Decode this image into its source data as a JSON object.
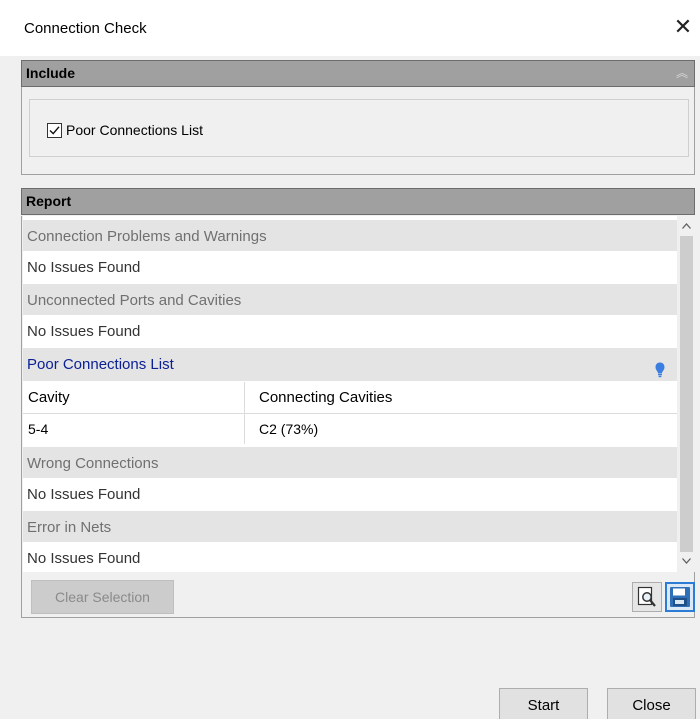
{
  "window": {
    "title": "Connection Check",
    "close_glyph": "✕"
  },
  "include": {
    "header": "Include",
    "collapse_glyph": "︽",
    "checkbox": {
      "label": "Poor Connections List",
      "checked": true
    }
  },
  "report": {
    "header": "Report",
    "groups": [
      {
        "title": "Connection Problems and Warnings",
        "value": "No Issues Found"
      },
      {
        "title": "Unconnected Ports and Cavities",
        "value": "No Issues Found"
      },
      {
        "title": "Poor Connections List",
        "icon": "lightbulb-icon"
      },
      {
        "title": "Wrong Connections",
        "value": "No Issues Found"
      },
      {
        "title": "Error in Nets",
        "value": "No Issues Found"
      }
    ],
    "table": {
      "columns": [
        "Cavity",
        "Connecting Cavities"
      ],
      "rows": [
        [
          "5-4",
          "C2 (73%)"
        ]
      ]
    },
    "clear_selection": "Clear Selection"
  },
  "buttons": {
    "start": "Start",
    "close": "Close"
  },
  "colors": {
    "accent": "#2c7cd6",
    "link": "#0c2096",
    "header_gray": "#a0a0a0",
    "bulb": "#3a7fe0"
  }
}
